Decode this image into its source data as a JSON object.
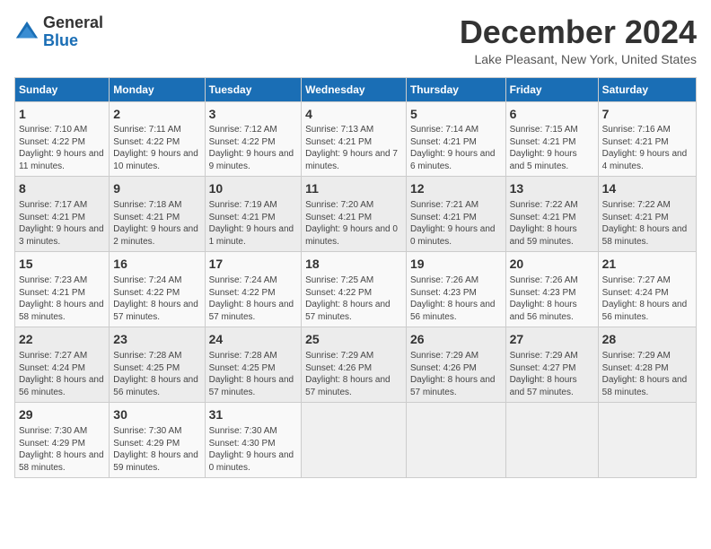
{
  "header": {
    "logo_general": "General",
    "logo_blue": "Blue",
    "title": "December 2024",
    "subtitle": "Lake Pleasant, New York, United States"
  },
  "weekdays": [
    "Sunday",
    "Monday",
    "Tuesday",
    "Wednesday",
    "Thursday",
    "Friday",
    "Saturday"
  ],
  "weeks": [
    [
      {
        "day": 1,
        "info": "Sunrise: 7:10 AM\nSunset: 4:22 PM\nDaylight: 9 hours and 11 minutes."
      },
      {
        "day": 2,
        "info": "Sunrise: 7:11 AM\nSunset: 4:22 PM\nDaylight: 9 hours and 10 minutes."
      },
      {
        "day": 3,
        "info": "Sunrise: 7:12 AM\nSunset: 4:22 PM\nDaylight: 9 hours and 9 minutes."
      },
      {
        "day": 4,
        "info": "Sunrise: 7:13 AM\nSunset: 4:21 PM\nDaylight: 9 hours and 7 minutes."
      },
      {
        "day": 5,
        "info": "Sunrise: 7:14 AM\nSunset: 4:21 PM\nDaylight: 9 hours and 6 minutes."
      },
      {
        "day": 6,
        "info": "Sunrise: 7:15 AM\nSunset: 4:21 PM\nDaylight: 9 hours and 5 minutes."
      },
      {
        "day": 7,
        "info": "Sunrise: 7:16 AM\nSunset: 4:21 PM\nDaylight: 9 hours and 4 minutes."
      }
    ],
    [
      {
        "day": 8,
        "info": "Sunrise: 7:17 AM\nSunset: 4:21 PM\nDaylight: 9 hours and 3 minutes."
      },
      {
        "day": 9,
        "info": "Sunrise: 7:18 AM\nSunset: 4:21 PM\nDaylight: 9 hours and 2 minutes."
      },
      {
        "day": 10,
        "info": "Sunrise: 7:19 AM\nSunset: 4:21 PM\nDaylight: 9 hours and 1 minute."
      },
      {
        "day": 11,
        "info": "Sunrise: 7:20 AM\nSunset: 4:21 PM\nDaylight: 9 hours and 0 minutes."
      },
      {
        "day": 12,
        "info": "Sunrise: 7:21 AM\nSunset: 4:21 PM\nDaylight: 9 hours and 0 minutes."
      },
      {
        "day": 13,
        "info": "Sunrise: 7:22 AM\nSunset: 4:21 PM\nDaylight: 8 hours and 59 minutes."
      },
      {
        "day": 14,
        "info": "Sunrise: 7:22 AM\nSunset: 4:21 PM\nDaylight: 8 hours and 58 minutes."
      }
    ],
    [
      {
        "day": 15,
        "info": "Sunrise: 7:23 AM\nSunset: 4:21 PM\nDaylight: 8 hours and 58 minutes."
      },
      {
        "day": 16,
        "info": "Sunrise: 7:24 AM\nSunset: 4:22 PM\nDaylight: 8 hours and 57 minutes."
      },
      {
        "day": 17,
        "info": "Sunrise: 7:24 AM\nSunset: 4:22 PM\nDaylight: 8 hours and 57 minutes."
      },
      {
        "day": 18,
        "info": "Sunrise: 7:25 AM\nSunset: 4:22 PM\nDaylight: 8 hours and 57 minutes."
      },
      {
        "day": 19,
        "info": "Sunrise: 7:26 AM\nSunset: 4:23 PM\nDaylight: 8 hours and 56 minutes."
      },
      {
        "day": 20,
        "info": "Sunrise: 7:26 AM\nSunset: 4:23 PM\nDaylight: 8 hours and 56 minutes."
      },
      {
        "day": 21,
        "info": "Sunrise: 7:27 AM\nSunset: 4:24 PM\nDaylight: 8 hours and 56 minutes."
      }
    ],
    [
      {
        "day": 22,
        "info": "Sunrise: 7:27 AM\nSunset: 4:24 PM\nDaylight: 8 hours and 56 minutes."
      },
      {
        "day": 23,
        "info": "Sunrise: 7:28 AM\nSunset: 4:25 PM\nDaylight: 8 hours and 56 minutes."
      },
      {
        "day": 24,
        "info": "Sunrise: 7:28 AM\nSunset: 4:25 PM\nDaylight: 8 hours and 57 minutes."
      },
      {
        "day": 25,
        "info": "Sunrise: 7:29 AM\nSunset: 4:26 PM\nDaylight: 8 hours and 57 minutes."
      },
      {
        "day": 26,
        "info": "Sunrise: 7:29 AM\nSunset: 4:26 PM\nDaylight: 8 hours and 57 minutes."
      },
      {
        "day": 27,
        "info": "Sunrise: 7:29 AM\nSunset: 4:27 PM\nDaylight: 8 hours and 57 minutes."
      },
      {
        "day": 28,
        "info": "Sunrise: 7:29 AM\nSunset: 4:28 PM\nDaylight: 8 hours and 58 minutes."
      }
    ],
    [
      {
        "day": 29,
        "info": "Sunrise: 7:30 AM\nSunset: 4:29 PM\nDaylight: 8 hours and 58 minutes."
      },
      {
        "day": 30,
        "info": "Sunrise: 7:30 AM\nSunset: 4:29 PM\nDaylight: 8 hours and 59 minutes."
      },
      {
        "day": 31,
        "info": "Sunrise: 7:30 AM\nSunset: 4:30 PM\nDaylight: 9 hours and 0 minutes."
      },
      null,
      null,
      null,
      null
    ]
  ]
}
